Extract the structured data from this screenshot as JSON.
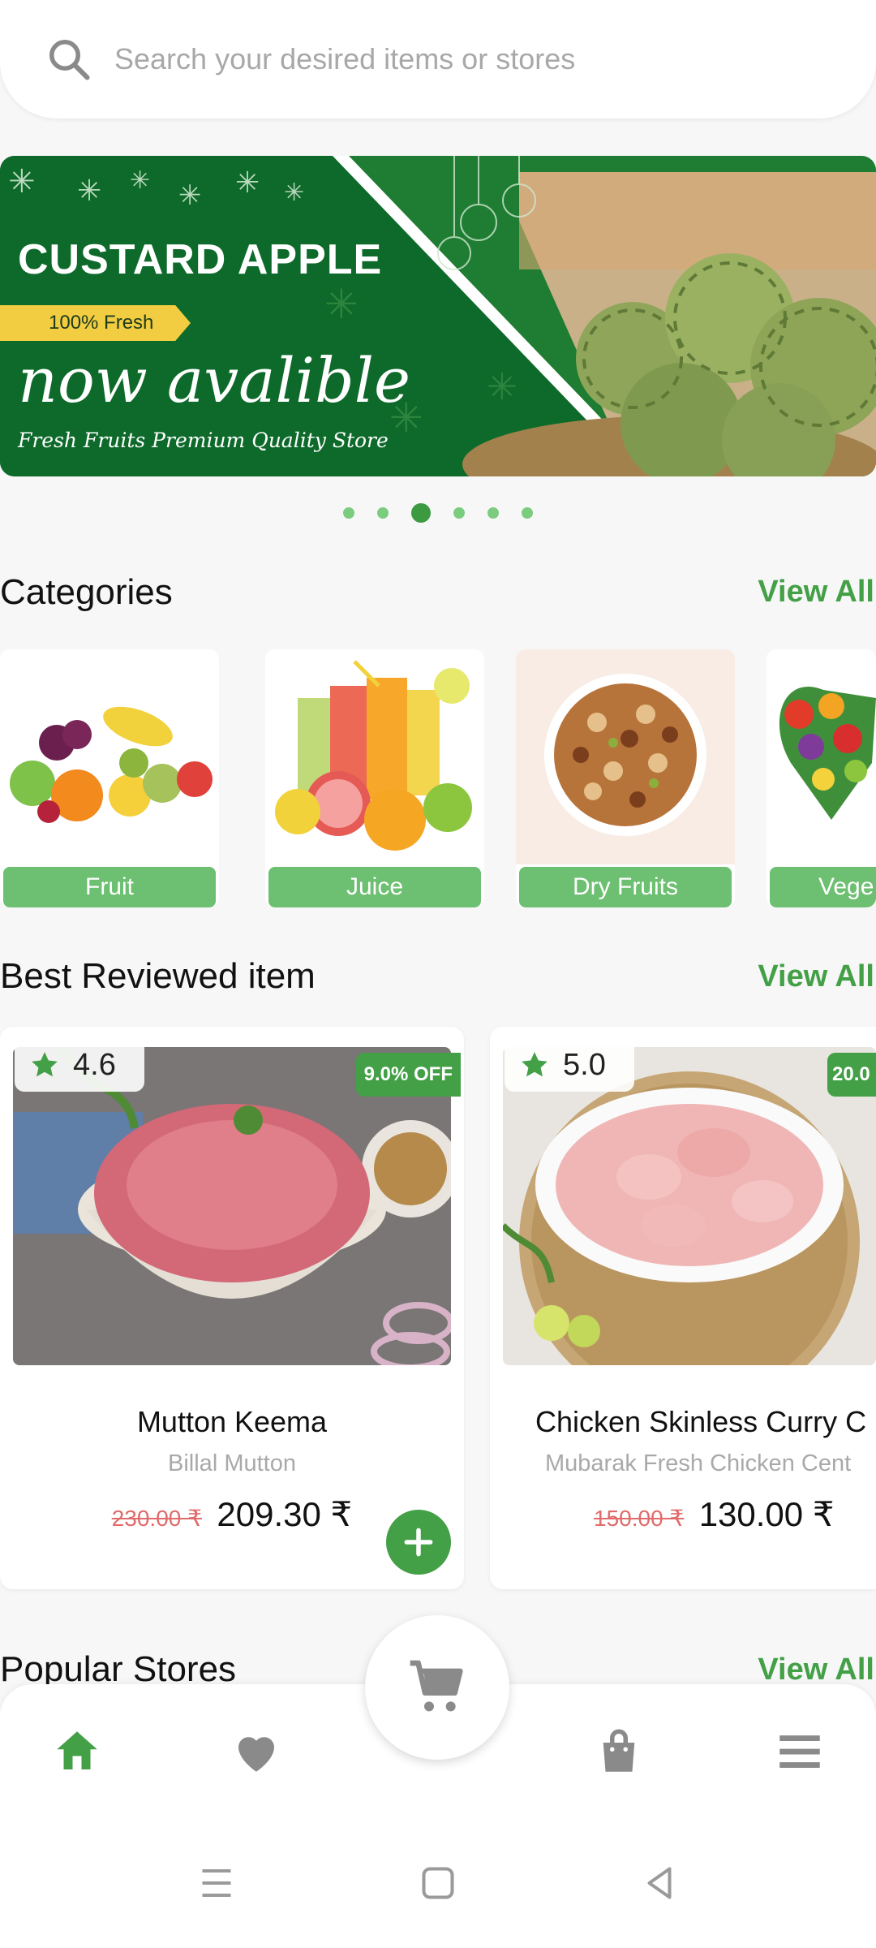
{
  "search": {
    "placeholder": "Search your desired items or stores",
    "icon": "search-icon"
  },
  "banner": {
    "title": "CUSTARD APPLE",
    "tag": "100% Fresh",
    "headline": "now avalible",
    "subtitle": "Fresh Fruits Premium Quality Store",
    "dots_total": 6,
    "dots_active": 3,
    "color": "#0e6a2a"
  },
  "categories": {
    "title": "Categories",
    "view_all": "View All",
    "items": [
      {
        "label": "Fruit"
      },
      {
        "label": "Juice"
      },
      {
        "label": "Dry Fruits"
      },
      {
        "label": "Vege"
      }
    ]
  },
  "best_reviewed": {
    "title": "Best Reviewed item",
    "view_all": "View All",
    "items": [
      {
        "rating": "4.6",
        "discount": "9.0% OFF",
        "name": "Mutton Keema",
        "store": "Billal Mutton",
        "old_price": "230.00 ₹",
        "price": "209.30 ₹"
      },
      {
        "rating": "5.0",
        "discount": "20.0",
        "name": "Chicken Skinless Curry C",
        "store": "Mubarak Fresh Chicken Cent",
        "old_price": "150.00 ₹",
        "price": "130.00 ₹"
      }
    ]
  },
  "popular_stores": {
    "title": "Popular Stores",
    "view_all": "View All"
  },
  "bottom_nav": {
    "items": [
      "home-icon",
      "heart-icon",
      "cart-icon",
      "shopping-bag-icon",
      "menu-icon"
    ],
    "active": "home-icon",
    "accent": "#43a047",
    "inactive": "#8a8a8a"
  },
  "system_nav": [
    "recents-icon",
    "home-square-icon",
    "back-icon"
  ]
}
